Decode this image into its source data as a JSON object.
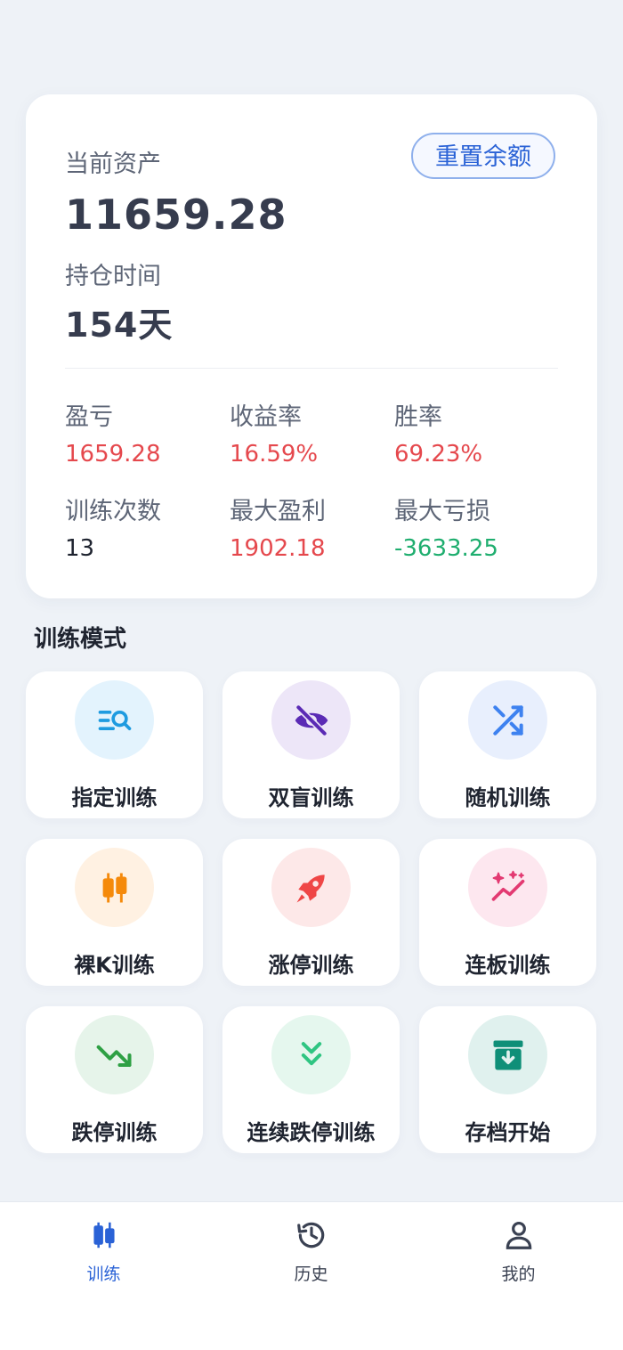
{
  "asset": {
    "current_label": "当前资产",
    "current_value": "11659.28",
    "hold_label": "持仓时间",
    "hold_value": "154天",
    "reset_button": "重置余额"
  },
  "stats": [
    {
      "label": "盈亏",
      "value": "1659.28",
      "tone": "red"
    },
    {
      "label": "收益率",
      "value": "16.59%",
      "tone": "red"
    },
    {
      "label": "胜率",
      "value": "69.23%",
      "tone": "red"
    },
    {
      "label": "训练次数",
      "value": "13",
      "tone": "dark"
    },
    {
      "label": "最大盈利",
      "value": "1902.18",
      "tone": "red"
    },
    {
      "label": "最大亏损",
      "value": "-3633.25",
      "tone": "green"
    }
  ],
  "modes_title": "训练模式",
  "modes": [
    {
      "label": "指定训练",
      "icon": "search-list-icon",
      "bg": "#e3f3fd",
      "color": "#1e9be0"
    },
    {
      "label": "双盲训练",
      "icon": "eye-off-icon",
      "bg": "#ede6f8",
      "color": "#5b2bb5"
    },
    {
      "label": "随机训练",
      "icon": "shuffle-icon",
      "bg": "#e8effd",
      "color": "#3e82f0"
    },
    {
      "label": "裸K训练",
      "icon": "candlestick-icon",
      "bg": "#fff1e2",
      "color": "#f58a0b"
    },
    {
      "label": "涨停训练",
      "icon": "rocket-icon",
      "bg": "#fde8e8",
      "color": "#ef4646"
    },
    {
      "label": "连板训练",
      "icon": "sparkle-chart-icon",
      "bg": "#fde7ef",
      "color": "#e33a72"
    },
    {
      "label": "跌停训练",
      "icon": "trending-down-icon",
      "bg": "#e6f4ea",
      "color": "#2ea044"
    },
    {
      "label": "连续跌停训练",
      "icon": "double-chevron-down-icon",
      "bg": "#e5f7ee",
      "color": "#2fc582"
    },
    {
      "label": "存档开始",
      "icon": "archive-icon",
      "bg": "#e0f1ee",
      "color": "#0f8f78"
    }
  ],
  "nav": [
    {
      "label": "训练",
      "icon": "candlestick-icon",
      "active": true
    },
    {
      "label": "历史",
      "icon": "history-icon",
      "active": false
    },
    {
      "label": "我的",
      "icon": "user-icon",
      "active": false
    }
  ],
  "colors": {
    "accent": "#2a62d6",
    "profit_red": "#e5484d",
    "loss_green": "#1fae6f",
    "nav_inactive": "#3a4152"
  }
}
